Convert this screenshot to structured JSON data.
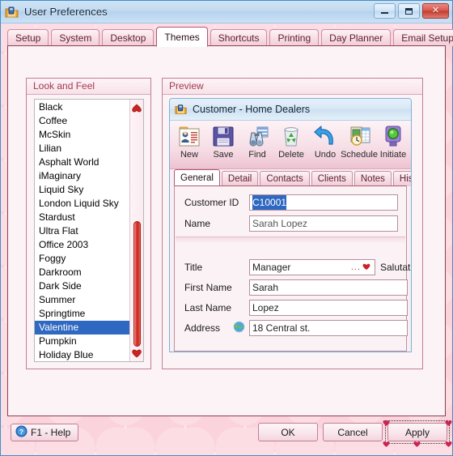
{
  "window": {
    "title": "User Preferences",
    "icon": "folder-preferences-icon",
    "buttons": {
      "minimize": "minimize-icon",
      "restore": "restore-icon",
      "close": "✕"
    }
  },
  "tabs": [
    {
      "label": "Setup",
      "active": false
    },
    {
      "label": "System",
      "active": false
    },
    {
      "label": "Desktop",
      "active": false
    },
    {
      "label": "Themes",
      "active": true
    },
    {
      "label": "Shortcuts",
      "active": false
    },
    {
      "label": "Printing",
      "active": false
    },
    {
      "label": "Day Planner",
      "active": false
    },
    {
      "label": "Email Setup",
      "active": false
    }
  ],
  "look_and_feel": {
    "title": "Look and Feel",
    "selected": "Valentine",
    "items": [
      "Black",
      "Coffee",
      "McSkin",
      "Lilian",
      "Asphalt World",
      "iMaginary",
      "Liquid Sky",
      "London Liquid Sky",
      "Stardust",
      "Ultra Flat",
      "Office 2003",
      "Foggy",
      "Darkroom",
      "Dark Side",
      "Summer",
      "Springtime",
      "Valentine",
      "Pumpkin",
      "Holiday Blue"
    ],
    "scrollbar": {
      "up_arrow": "heart-up-icon",
      "down_arrow": "heart-down-icon"
    }
  },
  "preview": {
    "title": "Preview",
    "inner_window": {
      "title": "Customer - Home Dealers",
      "icon": "folder-customer-icon",
      "toolbar": [
        {
          "label": "New",
          "icon": "new-record-icon"
        },
        {
          "label": "Save",
          "icon": "floppy-disk-icon"
        },
        {
          "label": "Find",
          "icon": "binoculars-icon"
        },
        {
          "label": "Delete",
          "icon": "recycle-bin-icon"
        },
        {
          "label": "Undo",
          "icon": "undo-arrow-icon"
        },
        {
          "label": "Schedule",
          "icon": "calendar-clock-icon"
        },
        {
          "label": "Initiate",
          "icon": "traffic-light-icon"
        }
      ],
      "tabs": [
        {
          "label": "General",
          "active": true
        },
        {
          "label": "Detail",
          "active": false
        },
        {
          "label": "Contacts",
          "active": false
        },
        {
          "label": "Clients",
          "active": false
        },
        {
          "label": "Notes",
          "active": false
        },
        {
          "label": "Hist",
          "active": false
        }
      ],
      "fields": {
        "customer_id_label": "Customer ID",
        "customer_id_value": "C10001",
        "name_label": "Name",
        "name_value": "Sarah Lopez",
        "title_label": "Title",
        "title_value": "Manager",
        "title_ellipsis": "...",
        "title_dropdown_icon": "heart-dropdown-icon",
        "salutation_label": "Salutation",
        "first_name_label": "First Name",
        "first_name_value": "Sarah",
        "last_name_label": "Last Name",
        "last_name_value": "Lopez",
        "address_label": "Address",
        "address_icon": "globe-icon",
        "address_value": "18 Central st."
      }
    }
  },
  "footer": {
    "help": {
      "label": "F1 - Help",
      "icon": "question-mark-icon"
    },
    "ok": "OK",
    "cancel": "Cancel",
    "apply": "Apply"
  },
  "colors": {
    "accent_pink": "#f2ccd7",
    "border_rose": "#c07f93",
    "selection_blue": "#2f68c0",
    "heart_red": "#cc2222",
    "title_blue": "#c2daf0"
  }
}
